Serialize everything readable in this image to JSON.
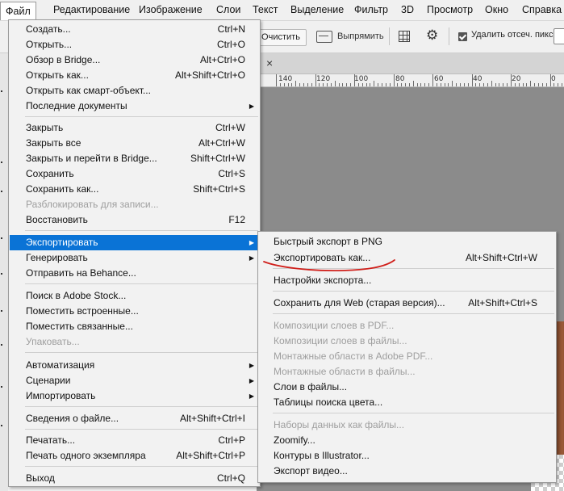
{
  "menubar": {
    "items": [
      "Файл",
      "Редактирование",
      "Изображение",
      "Слои",
      "Текст",
      "Выделение",
      "Фильтр",
      "3D",
      "Просмотр",
      "Окно",
      "Справка"
    ]
  },
  "options_bar": {
    "clear_label": "Очистить",
    "straighten_label": "Выпрямить",
    "delete_cropped_label": "Удалить отсеч. пикс.",
    "delete_cropped_checked": true
  },
  "ruler": {
    "labels": [
      "140",
      "120",
      "100",
      "80",
      "60",
      "40",
      "20",
      "0"
    ]
  },
  "file_menu": {
    "items": [
      {
        "label": "Создать...",
        "shortcut": "Ctrl+N"
      },
      {
        "label": "Открыть...",
        "shortcut": "Ctrl+O"
      },
      {
        "label": "Обзор в Bridge...",
        "shortcut": "Alt+Ctrl+O"
      },
      {
        "label": "Открыть как...",
        "shortcut": "Alt+Shift+Ctrl+O"
      },
      {
        "label": "Открыть как смарт-объект...",
        "shortcut": ""
      },
      {
        "label": "Последние документы",
        "shortcut": "",
        "submenu": true
      },
      {
        "label": "Закрыть",
        "shortcut": "Ctrl+W"
      },
      {
        "label": "Закрыть все",
        "shortcut": "Alt+Ctrl+W"
      },
      {
        "label": "Закрыть и перейти в Bridge...",
        "shortcut": "Shift+Ctrl+W"
      },
      {
        "label": "Сохранить",
        "shortcut": "Ctrl+S"
      },
      {
        "label": "Сохранить как...",
        "shortcut": "Shift+Ctrl+S"
      },
      {
        "label": "Разблокировать для записи...",
        "shortcut": "",
        "disabled": true
      },
      {
        "label": "Восстановить",
        "shortcut": "F12"
      },
      {
        "label": "Экспортировать",
        "shortcut": "",
        "submenu": true,
        "highlighted": true
      },
      {
        "label": "Генерировать",
        "shortcut": "",
        "submenu": true
      },
      {
        "label": "Отправить на Behance...",
        "shortcut": ""
      },
      {
        "label": "Поиск в Adobe Stock...",
        "shortcut": ""
      },
      {
        "label": "Поместить встроенные...",
        "shortcut": ""
      },
      {
        "label": "Поместить связанные...",
        "shortcut": ""
      },
      {
        "label": "Упаковать...",
        "shortcut": "",
        "disabled": true
      },
      {
        "label": "Автоматизация",
        "shortcut": "",
        "submenu": true
      },
      {
        "label": "Сценарии",
        "shortcut": "",
        "submenu": true
      },
      {
        "label": "Импортировать",
        "shortcut": "",
        "submenu": true
      },
      {
        "label": "Сведения о файле...",
        "shortcut": "Alt+Shift+Ctrl+I"
      },
      {
        "label": "Печатать...",
        "shortcut": "Ctrl+P"
      },
      {
        "label": "Печать одного экземпляра",
        "shortcut": "Alt+Shift+Ctrl+P"
      },
      {
        "label": "Выход",
        "shortcut": "Ctrl+Q"
      }
    ]
  },
  "export_menu": {
    "items": [
      {
        "label": "Быстрый экспорт в PNG",
        "shortcut": ""
      },
      {
        "label": "Экспортировать как...",
        "shortcut": "Alt+Shift+Ctrl+W"
      },
      {
        "label": "Настройки экспорта...",
        "shortcut": ""
      },
      {
        "label": "Сохранить для Web (старая версия)...",
        "shortcut": "Alt+Shift+Ctrl+S"
      },
      {
        "label": "Композиции слоев в PDF...",
        "shortcut": "",
        "disabled": true
      },
      {
        "label": "Композиции слоев в файлы...",
        "shortcut": "",
        "disabled": true
      },
      {
        "label": "Монтажные области в Adobe PDF...",
        "shortcut": "",
        "disabled": true
      },
      {
        "label": "Монтажные области в файлы...",
        "shortcut": "",
        "disabled": true
      },
      {
        "label": "Слои в файлы...",
        "shortcut": ""
      },
      {
        "label": "Таблицы поиска цвета...",
        "shortcut": ""
      },
      {
        "label": "Наборы данных как файлы...",
        "shortcut": "",
        "disabled": true
      },
      {
        "label": "Zoomify...",
        "shortcut": ""
      },
      {
        "label": "Контуры в Illustrator...",
        "shortcut": ""
      },
      {
        "label": "Экспорт видео...",
        "shortcut": ""
      }
    ]
  },
  "colors": {
    "highlight": "#0a73d6",
    "annotation": "#d0201b"
  }
}
